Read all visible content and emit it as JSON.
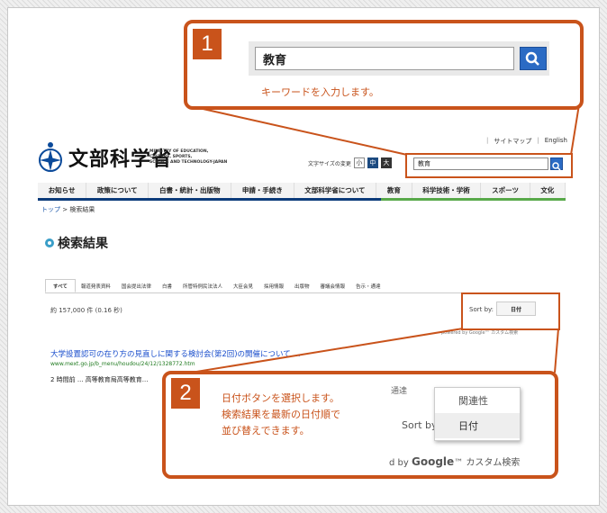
{
  "callout1": {
    "number": "1",
    "search_value": "教育",
    "instruction": "キーワードを入力します。"
  },
  "callout2": {
    "number": "2",
    "instruction_lines": [
      "日付ボタンを選択します。",
      "検索結果を最新の日付順で",
      "並び替えできます。"
    ],
    "zoom": {
      "tab_label": "通達",
      "sort_label": "Sort by",
      "options": [
        "関連性",
        "日付"
      ],
      "selected": "日付",
      "powered": "d by",
      "google": "Google",
      "powered_suffix": "™ カスタム検索"
    }
  },
  "site": {
    "logo_text": "文部科学省",
    "logo_sub": [
      "MINISTRY OF EDUCATION,",
      "CULTURE, SPORTS,",
      "SCIENCE AND TECHNOLOGY-JAPAN"
    ],
    "util_links": [
      "サイトマップ",
      "English"
    ],
    "font_size_label": "文字サイズの変更",
    "font_sizes": [
      "小",
      "中",
      "大"
    ],
    "search_value": "教育",
    "nav": [
      "お知らせ",
      "政策について",
      "白書・統計・出版物",
      "申請・手続き",
      "文部科学省について",
      "教育",
      "科学技術・学術",
      "スポーツ",
      "文化"
    ],
    "breadcrumb": {
      "home": "トップ",
      "sep": ">",
      "current": "検索結果"
    },
    "page_title": "検索結果",
    "tabs": [
      "すべて",
      "報道発表資料",
      "国会提出法律",
      "白書",
      "所管特例民法法人",
      "大臣会見",
      "採用情報",
      "出版物",
      "審議会情報",
      "告示・通達"
    ],
    "result_count": "約 157,000 件 (0.16 秒)",
    "sort_label": "Sort by:",
    "sort_button": "日付",
    "powered": "powered by Google™ カスタム検索",
    "result": {
      "title": "大学設置認可の在り方の見直しに関する検討会(第2回)の開催について ...",
      "url": "www.mext.go.jp/b_menu/houdou/24/12/1328772.htm",
      "snippet": "2 時間前 ... 高等教育局高等教育..."
    }
  },
  "colors": {
    "accent": "#c9531b",
    "nav_blue": "#0c3b7a",
    "nav_green": "#58a94a",
    "search_blue": "#2b6bc4"
  }
}
